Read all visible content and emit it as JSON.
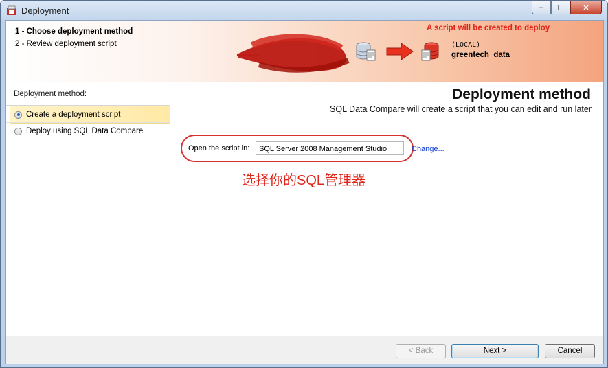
{
  "window": {
    "title": "Deployment",
    "controls": {
      "minimize": "‒",
      "maximize": "☐",
      "close": "✕"
    }
  },
  "header": {
    "steps": [
      "1 - Choose deployment method",
      "2 - Review deployment script"
    ],
    "deploy_note": "A script will be created to deploy",
    "target": {
      "server": "(LOCAL)",
      "database": "greentech_data"
    }
  },
  "left_panel": {
    "heading": "Deployment method:",
    "options": [
      {
        "label": "Create a deployment script",
        "selected": true
      },
      {
        "label": "Deploy using SQL Data Compare",
        "selected": false
      }
    ]
  },
  "main": {
    "title": "Deployment method",
    "subtitle": "SQL Data Compare will create a script that you can edit and run later",
    "script_label": "Open the script in:",
    "script_value": "SQL Server 2008 Management Studio",
    "change_link": "Change...",
    "annotation": "选择你的SQL管理器"
  },
  "footer": {
    "back": "< Back",
    "next": "Next >",
    "cancel": "Cancel"
  },
  "colors": {
    "accent_red": "#e0241a",
    "link_blue": "#0b3bd6",
    "header_orange": "#f4a47f",
    "selected_row": "#ffe9a6"
  }
}
